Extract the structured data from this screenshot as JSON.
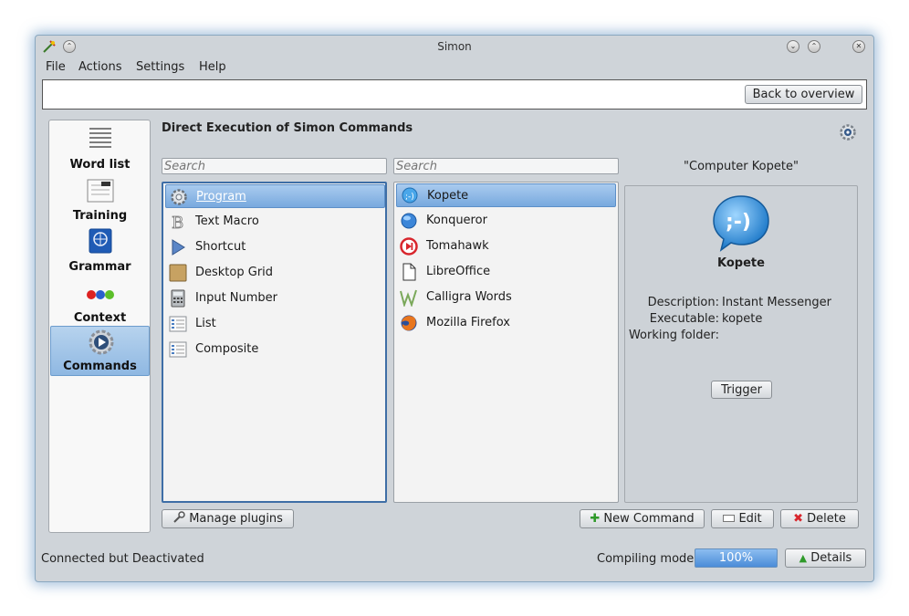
{
  "window": {
    "title": "Simon"
  },
  "menu": [
    "File",
    "Actions",
    "Settings",
    "Help"
  ],
  "toolbar": {
    "back_label": "Back to overview"
  },
  "sidebar": {
    "items": [
      {
        "label": "Word list",
        "icon": "list-icon"
      },
      {
        "label": "Training",
        "icon": "training-icon"
      },
      {
        "label": "Grammar",
        "icon": "grammar-icon"
      },
      {
        "label": "Context",
        "icon": "context-icon"
      },
      {
        "label": "Commands",
        "icon": "commands-icon",
        "active": true
      }
    ]
  },
  "main": {
    "heading": "Direct Execution of Simon Commands",
    "search_left_placeholder": "Search",
    "search_right_placeholder": "Search",
    "plugin_types": [
      {
        "label": "Program",
        "icon": "gear-icon",
        "selected": true
      },
      {
        "label": "Text Macro",
        "icon": "text-macro-icon"
      },
      {
        "label": "Shortcut",
        "icon": "shortcut-icon"
      },
      {
        "label": "Desktop Grid",
        "icon": "desktop-grid-icon"
      },
      {
        "label": "Input Number",
        "icon": "calculator-icon"
      },
      {
        "label": "List",
        "icon": "list-view-icon"
      },
      {
        "label": "Composite",
        "icon": "composite-icon"
      }
    ],
    "commands": [
      {
        "label": "Kopete",
        "icon": "kopete-icon",
        "selected": true
      },
      {
        "label": "Konqueror",
        "icon": "konqueror-icon"
      },
      {
        "label": "Tomahawk",
        "icon": "tomahawk-icon"
      },
      {
        "label": "LibreOffice",
        "icon": "libreoffice-icon"
      },
      {
        "label": "Calligra Words",
        "icon": "calligra-icon"
      },
      {
        "label": "Mozilla Firefox",
        "icon": "firefox-icon"
      }
    ],
    "detail": {
      "trigger_title": "\"Computer Kopete\"",
      "name": "Kopete",
      "description_key": "Description:",
      "description_value": "Instant Messenger",
      "executable_key": "Executable:",
      "executable_value": "kopete",
      "working_folder_key": "Working folder:",
      "working_folder_value": "",
      "trigger_label": "Trigger"
    },
    "buttons": {
      "manage_plugins": "Manage plugins",
      "new_command": "New Command",
      "edit": "Edit",
      "delete": "Delete"
    }
  },
  "status": {
    "connection": "Connected but Deactivated",
    "compiling": "Compiling model",
    "progress_text": "100%",
    "progress_value": 1.0,
    "details_label": "Details"
  },
  "colors": {
    "accent": "#4b8cd8",
    "selection": "#78a9de"
  }
}
